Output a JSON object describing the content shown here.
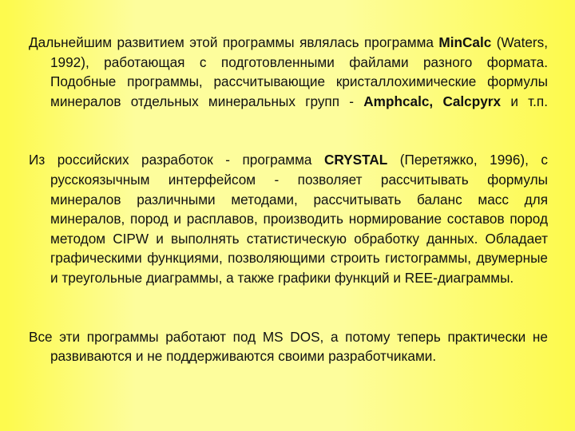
{
  "slide": {
    "background": {
      "edge_color": "#fdfa4e",
      "center_color": "#fdfd9c",
      "direction": "horizontal"
    },
    "text_color": "#111111",
    "language": "ru"
  },
  "paragraphs": [
    {
      "id": "paragraph-mincalc",
      "runs": [
        {
          "text": "Дальнейшим развитием этой программы являлась программа ",
          "bold": false
        },
        {
          "text": "MinCalc",
          "bold": true
        },
        {
          "text": " (Waters, 1992), работающая с подготовленными файлами разного формата. Подобные программы, рассчитывающие кристаллохимические формулы минералов отдельных минеральных групп - ",
          "bold": false
        },
        {
          "text": "Amphcalc, Calcpyrx",
          "bold": true
        },
        {
          "text": " и т.п.",
          "bold": false
        }
      ]
    },
    {
      "id": "paragraph-crystal",
      "runs": [
        {
          "text": "Из российских разработок - программа ",
          "bold": false
        },
        {
          "text": "CRYSTAL",
          "bold": true
        },
        {
          "text": " (Перетяжко, 1996), с русскоязычным интерфейсом - позволяет рассчитывать формулы минералов различными методами, рассчитывать баланс масс для минералов, пород и расплавов, производить нормирование составов пород методом CIPW и выполнять статистическую обработку данных. Обладает графическими функциями, позволяющими строить гистограммы, двумерные и треугольные диаграммы, а также графики функций и REE-диаграммы.",
          "bold": false
        }
      ]
    },
    {
      "id": "paragraph-msdos",
      "runs": [
        {
          "text": "Все эти программы работают под MS DOS, а потому теперь практически не развиваются и не поддерживаются своими разработчиками.",
          "bold": false
        }
      ]
    }
  ]
}
